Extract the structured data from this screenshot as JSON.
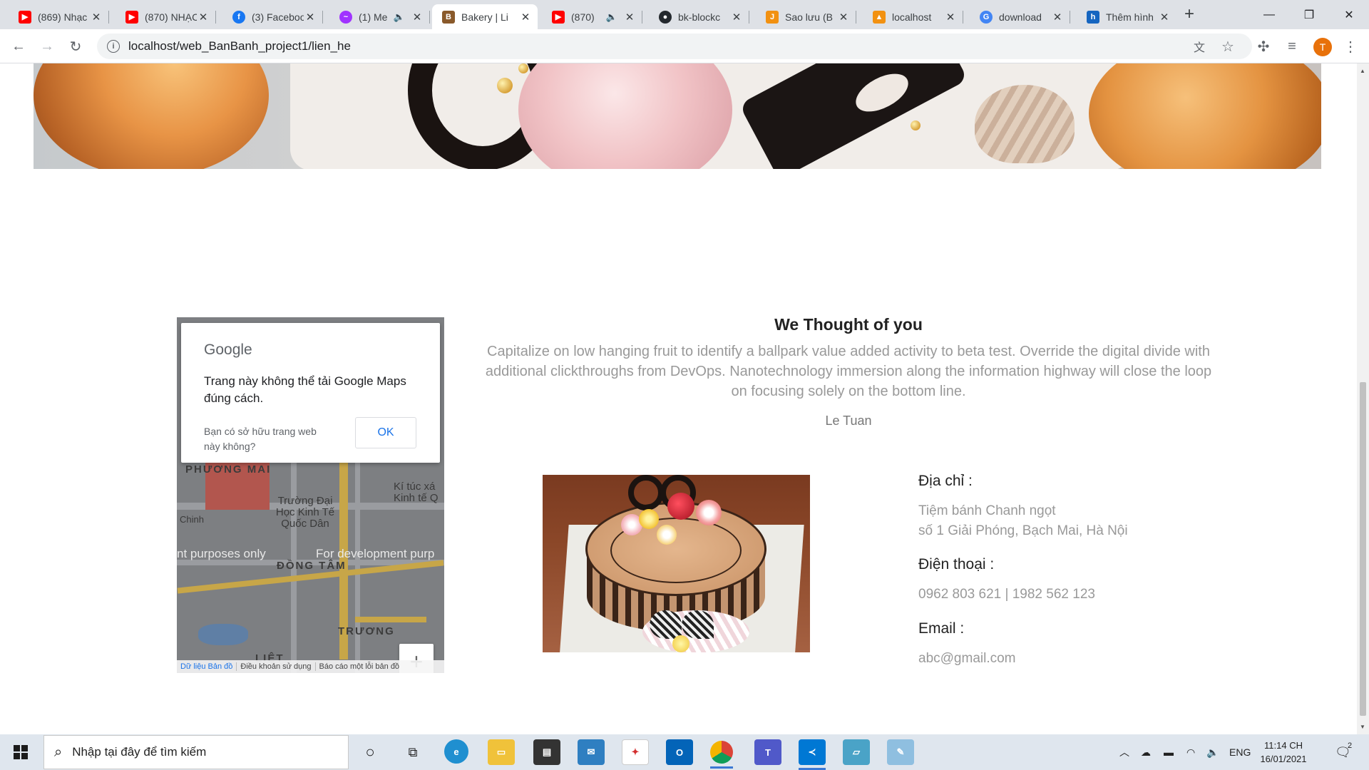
{
  "browser": {
    "tabs": [
      {
        "title": "(869) Nhạc",
        "favicon": "youtube-icon",
        "color": "#ff0000"
      },
      {
        "title": "(870) NHẠC",
        "favicon": "youtube-icon",
        "color": "#ff0000"
      },
      {
        "title": "(3) Facebook",
        "favicon": "facebook-icon",
        "color": "#1877f2"
      },
      {
        "title": "(1) Me",
        "favicon": "messenger-icon",
        "color": "#a033ff"
      },
      {
        "title": "Bakery | Li",
        "favicon": "bakery-icon",
        "color": "#8a5a2b"
      },
      {
        "title": "(870)",
        "favicon": "youtube-icon",
        "color": "#ff0000"
      },
      {
        "title": "bk-blockc",
        "favicon": "github-icon",
        "color": "#24292e"
      },
      {
        "title": "Sao lưu (B",
        "favicon": "j-icon",
        "color": "#f29111"
      },
      {
        "title": "localhost",
        "favicon": "phpmyadmin-icon",
        "color": "#f29111"
      },
      {
        "title": "download",
        "favicon": "google-icon",
        "color": "#4285f4"
      },
      {
        "title": "Thêm hình",
        "favicon": "h-icon",
        "color": "#1565c0"
      }
    ],
    "url": "localhost/web_BanBanh_project1/lien_he",
    "profile_initial": "T"
  },
  "map": {
    "dialog_logo": "Google",
    "dialog_message": "Trang này không thể tải Google Maps đúng cách.",
    "dialog_owner_question": "Bạn có sở hữu trang web này không?",
    "dialog_ok": "OK",
    "labels": {
      "district1": "PHƯƠNG MAI",
      "district2": "ĐỒNG TÂM",
      "district3": "TRƯƠNG",
      "district4": "LIỆT",
      "university": "Trường Đại Học Kinh Tế Quốc Dân",
      "dorm": "Kí túc xá Kinh tế Q",
      "street": "Chinh"
    },
    "watermark_left": "nt purposes only",
    "watermark_right": "For development purp",
    "zoom_in": "+",
    "zoom_out": "−",
    "footer": [
      "Dữ liệu Bản đồ",
      "Điều khoản sử dụng",
      "Báo cáo một lỗi bản đồ"
    ]
  },
  "content": {
    "heading": "We Thought of you",
    "paragraph": "Capitalize on low hanging fruit to identify a ballpark value added activity to beta test. Override the digital divide with additional clickthroughs from DevOps. Nanotechnology immersion along the information highway will close the loop on focusing solely on the bottom line.",
    "author": "Le Tuan",
    "address_label": "Địa chỉ :",
    "address_line1": "Tiệm bánh Chanh ngọt",
    "address_line2": "số 1 Giải Phóng, Bạch Mai, Hà Nội",
    "phone_label": "Điện thoại :",
    "phone_value": "0962 803 621 | 1982 562 123",
    "email_label": "Email :",
    "email_value": "abc@gmail.com"
  },
  "taskbar": {
    "search_placeholder": "Nhập tại đây để tìm kiếm",
    "language": "ENG",
    "time": "11:14 CH",
    "date": "16/01/2021",
    "notifications": "2"
  }
}
